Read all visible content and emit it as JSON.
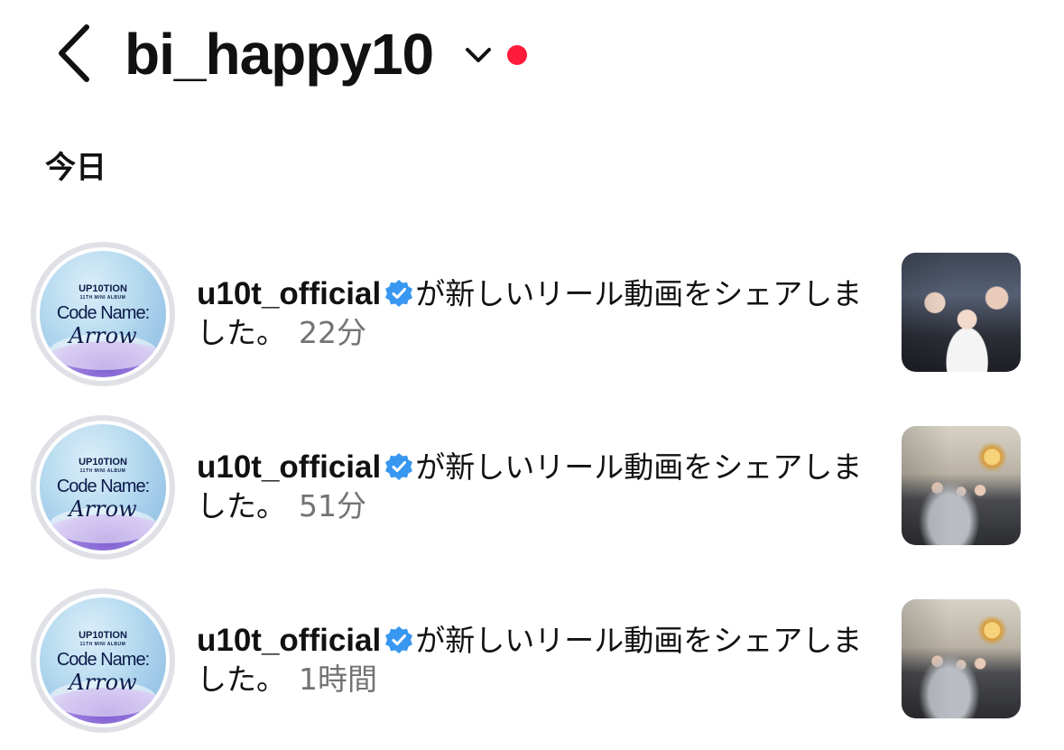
{
  "header": {
    "username": "bi_happy10",
    "back_icon": "chevron-left-icon",
    "dropdown_icon": "chevron-down-icon",
    "unread_dot_color": "#ff1b3a"
  },
  "section": {
    "title": "今日"
  },
  "avatar": {
    "line1": "UP10TION",
    "line2": "11TH MINI ALBUM",
    "line3": "Code Name:",
    "line4": "Arrow"
  },
  "notifications": [
    {
      "account": "u10t_official",
      "message": "が新しいリール動画をシェアしました。",
      "time": "22分",
      "verified": true,
      "thumbnail": "group-selfie-photo"
    },
    {
      "account": "u10t_official",
      "message": "が新しいリール動画をシェアしました。",
      "time": "51分",
      "verified": true,
      "thumbnail": "group-at-table-photo"
    },
    {
      "account": "u10t_official",
      "message": "が新しいリール動画をシェアしました。",
      "time": "1時間",
      "verified": true,
      "thumbnail": "group-at-table-photo"
    }
  ],
  "colors": {
    "verified_badge": "#3897f0",
    "secondary_text": "#737373"
  }
}
